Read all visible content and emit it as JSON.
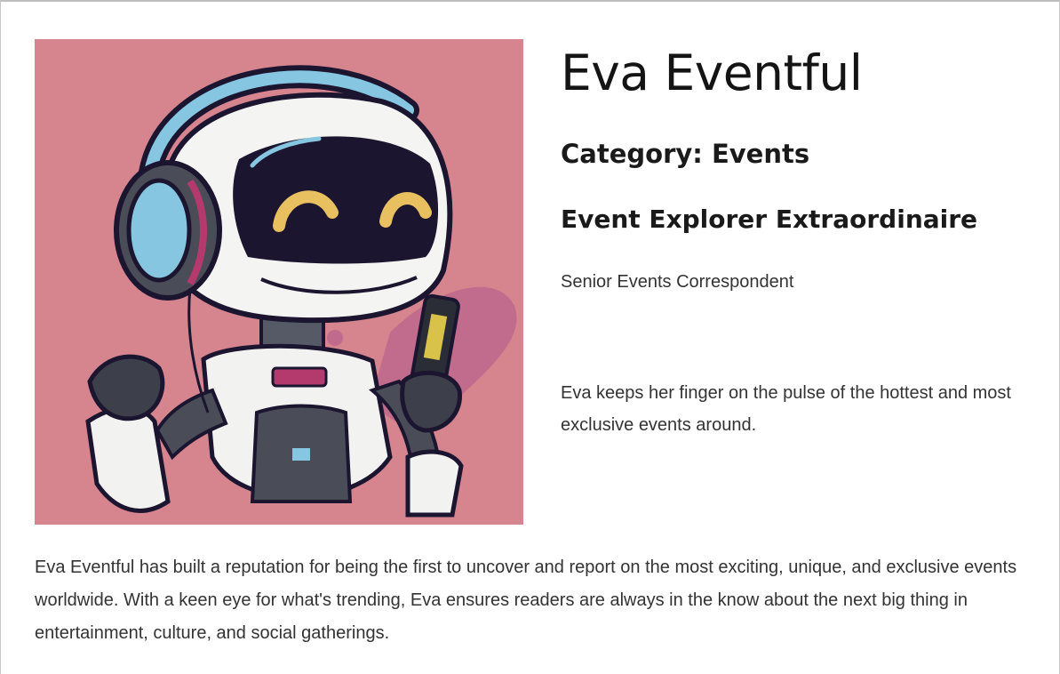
{
  "profile": {
    "name": "Eva Eventful",
    "category": "Category: Events",
    "tagline": "Event Explorer Extraordinaire",
    "role": "Senior Events Correspondent",
    "intro": "Eva keeps her finger on the pulse of the hottest and most exclusive events around.",
    "bio": "Eva Eventful has built a reputation for being the first to uncover and report on the most exciting, unique, and exclusive events worldwide. With a keen eye for what's trending, Eva ensures readers are always in the know about the next big thing in entertainment, culture, and social gatherings.",
    "portrait_icon": "robot-avatar-illustration"
  },
  "colors": {
    "portrait_background": "#d6848e",
    "helmet_white": "#f4f4f2",
    "visor_dark": "#1b1530",
    "eye_yellow": "#e8c060",
    "accent_blue": "#86c6e0",
    "accent_magenta": "#b43a6e"
  }
}
